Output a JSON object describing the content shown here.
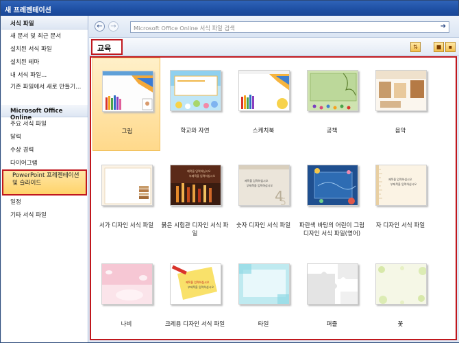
{
  "window": {
    "title": "새 프레젠테이션"
  },
  "sidebar": {
    "template_header": "서식 파일",
    "items_local": [
      "새 문서 및 최근 문서",
      "설치된 서식 파일",
      "설치된 테마",
      "내 서식 파일...",
      "기존 파일에서 새로 만들기..."
    ],
    "online_header": "Microsoft Office Online",
    "items_online": [
      "주요 서식 파일",
      "달력",
      "수상 경력",
      "다이어그램",
      "PowerPoint 프레젠테이션 및 슬라이드",
      "일정",
      "기타 서식 파일"
    ]
  },
  "toolbar": {
    "back_icon": "back-arrow-icon",
    "forward_icon": "forward-arrow-icon",
    "search_placeholder": "Microsoft Office Online 서식 파일 검색",
    "go_icon": "go-arrow-icon"
  },
  "category": {
    "title": "교육"
  },
  "view_icons": [
    "sort-icon",
    "large-icons-icon",
    "small-icons-icon"
  ],
  "gallery": {
    "items": [
      "그림",
      "학교와 자연",
      "스케치북",
      "공책",
      "음악",
      "서가 디자인 서식 파일",
      "붉은 시험관 디자인 서식 파일",
      "숫자 디자인 서식 파일",
      "파란색 바탕의 어린이 그림 디자인 서식 파일(영어)",
      "자 디자인 서식 파일",
      "나비",
      "크레용 디자인 서식 파일",
      "타일",
      "퍼즐",
      "꽃"
    ],
    "thumb_text": {
      "slide_title": "제목을 입력하십시오",
      "slide_subtitle": "부제목을 입력하십시오"
    }
  },
  "colors": {
    "selected": "#ffd36a",
    "highlight": "#c0171d",
    "titlebar": "#1e4fa3"
  }
}
